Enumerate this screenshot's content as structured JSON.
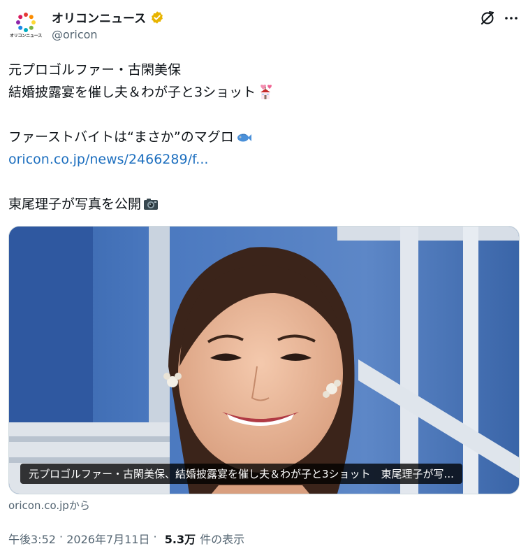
{
  "account": {
    "display_name": "オリコンニュース",
    "handle": "@oricon",
    "avatar_text": "オリコンニュース",
    "verified_color": "#e8b400"
  },
  "tweet": {
    "lines": [
      "元プロゴルファー・古閑美保",
      "結婚披露宴を催し夫＆わが子と3ショット",
      "",
      "ファーストバイトは“まさか”のマグロ",
      "oricon.co.jp/news/2466289/f...",
      "",
      "東尾理子が写真を公開"
    ],
    "emojis": [
      "wedding-emoji",
      "fish-emoji",
      "camera-emoji"
    ]
  },
  "media": {
    "caption": "元プロゴルファー・古閑美保、結婚披露宴を催し夫＆わが子と3ショット　東尾理子が写...",
    "source": "oricon.co.jpから"
  },
  "meta": {
    "time": "午後3:52",
    "separator": " · ",
    "date": "2026年7月11日",
    "views": "5.3万",
    "views_label": "件の表示"
  },
  "colors": {
    "link": "#1d6fbf",
    "muted": "#536471",
    "text": "#0f1419"
  }
}
